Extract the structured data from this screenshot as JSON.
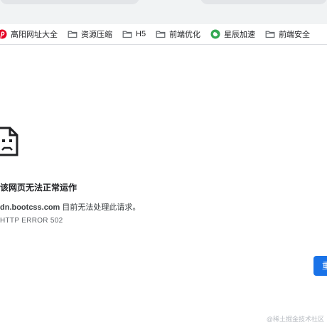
{
  "bookmarks": [
    {
      "label": "高阳网址大全",
      "icon": "pinterest-logo-icon"
    },
    {
      "label": "资源压缩",
      "icon": "folder-icon"
    },
    {
      "label": "H5",
      "icon": "folder-icon"
    },
    {
      "label": "前端优化",
      "icon": "folder-icon"
    },
    {
      "label": "星辰加速",
      "icon": "green-circle-logo-icon"
    },
    {
      "label": "前端安全",
      "icon": "folder-icon"
    }
  ],
  "error": {
    "title": "该网页无法正常运作",
    "host": "dn.bootcss.com",
    "message": " 目前无法处理此请求。",
    "code": "HTTP ERROR 502",
    "reload_label": "重"
  },
  "watermark": "@稀土掘金技术社区",
  "colors": {
    "accent": "#1a73e8",
    "pinterest": "#e60023",
    "green_logo": "#34a853"
  }
}
